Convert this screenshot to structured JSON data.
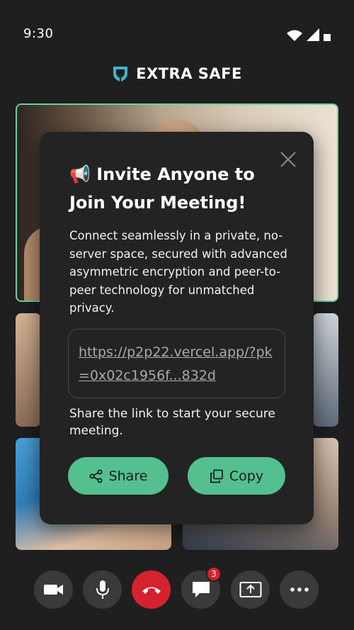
{
  "status_bar": {
    "time": "9:30"
  },
  "brand": {
    "name": "EXTRA SAFE",
    "logo_color": "#3fb5c9"
  },
  "modal": {
    "icon": "megaphone-icon",
    "title": "📢 Invite Anyone to Join Your Meeting!",
    "description": "Connect seamlessly in a private, no-server space, secured with advanced asymmetric encryption and peer-to-peer technology for unmatched privacy.",
    "link": "https://p2p22.vercel.app/?pk=0x02c1956f...832d",
    "share_note": "Share the link to start your secure meeting.",
    "share_label": "Share",
    "copy_label": "Copy",
    "accent_color": "#54c08f"
  },
  "controls": {
    "chat_badge": "3",
    "end_call_color": "#d4222f"
  }
}
